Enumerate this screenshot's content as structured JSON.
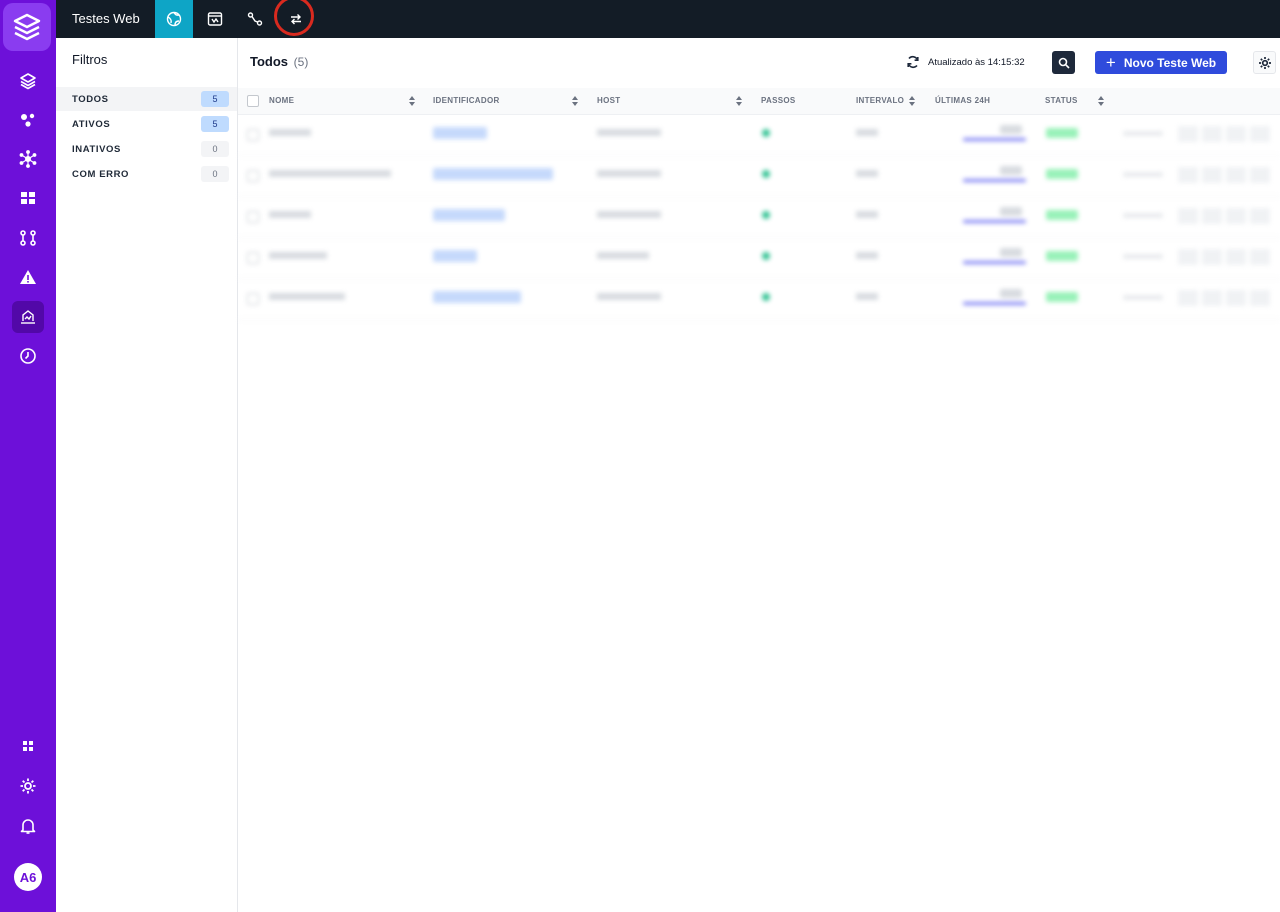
{
  "topbar": {
    "app_title": "Testes Web",
    "icons": [
      "globe-icon",
      "browser-window-icon",
      "route-icon",
      "transfer-arrows-icon"
    ]
  },
  "rail": {
    "icons": [
      "logo-layers-icon",
      "layers-icon",
      "nodes-icon",
      "network-hub-icon",
      "dashboard-icon",
      "git-branch-icon",
      "alert-icon",
      "web-test-icon",
      "clock-compass-icon",
      "apps-grid-icon",
      "gear-icon",
      "bell-icon"
    ],
    "avatar": "A6"
  },
  "filters": {
    "title": "Filtros",
    "items": [
      {
        "label": "TODOS",
        "count": "5"
      },
      {
        "label": "ATIVOS",
        "count": "5"
      },
      {
        "label": "INATIVOS",
        "count": "0"
      },
      {
        "label": "COM ERRO",
        "count": "0"
      }
    ]
  },
  "main": {
    "title": "Todos",
    "count": "(5)",
    "updated": "Atualizado às 14:15:32",
    "new_button": "Novo Teste Web"
  },
  "table": {
    "headers": {
      "nome": "NOME",
      "identificador": "IDENTIFICADOR",
      "host": "HOST",
      "passos": "PASSOS",
      "intervalo": "INTERVALO",
      "ultimas": "ÚLTIMAS 24H",
      "status": "STATUS"
    }
  },
  "colors": {
    "rail": "#6d10d9",
    "topbar": "#131c26",
    "active_tab": "#0ea5c6",
    "primary": "#2f4bdc",
    "highlight_ring": "#d92a1f"
  }
}
